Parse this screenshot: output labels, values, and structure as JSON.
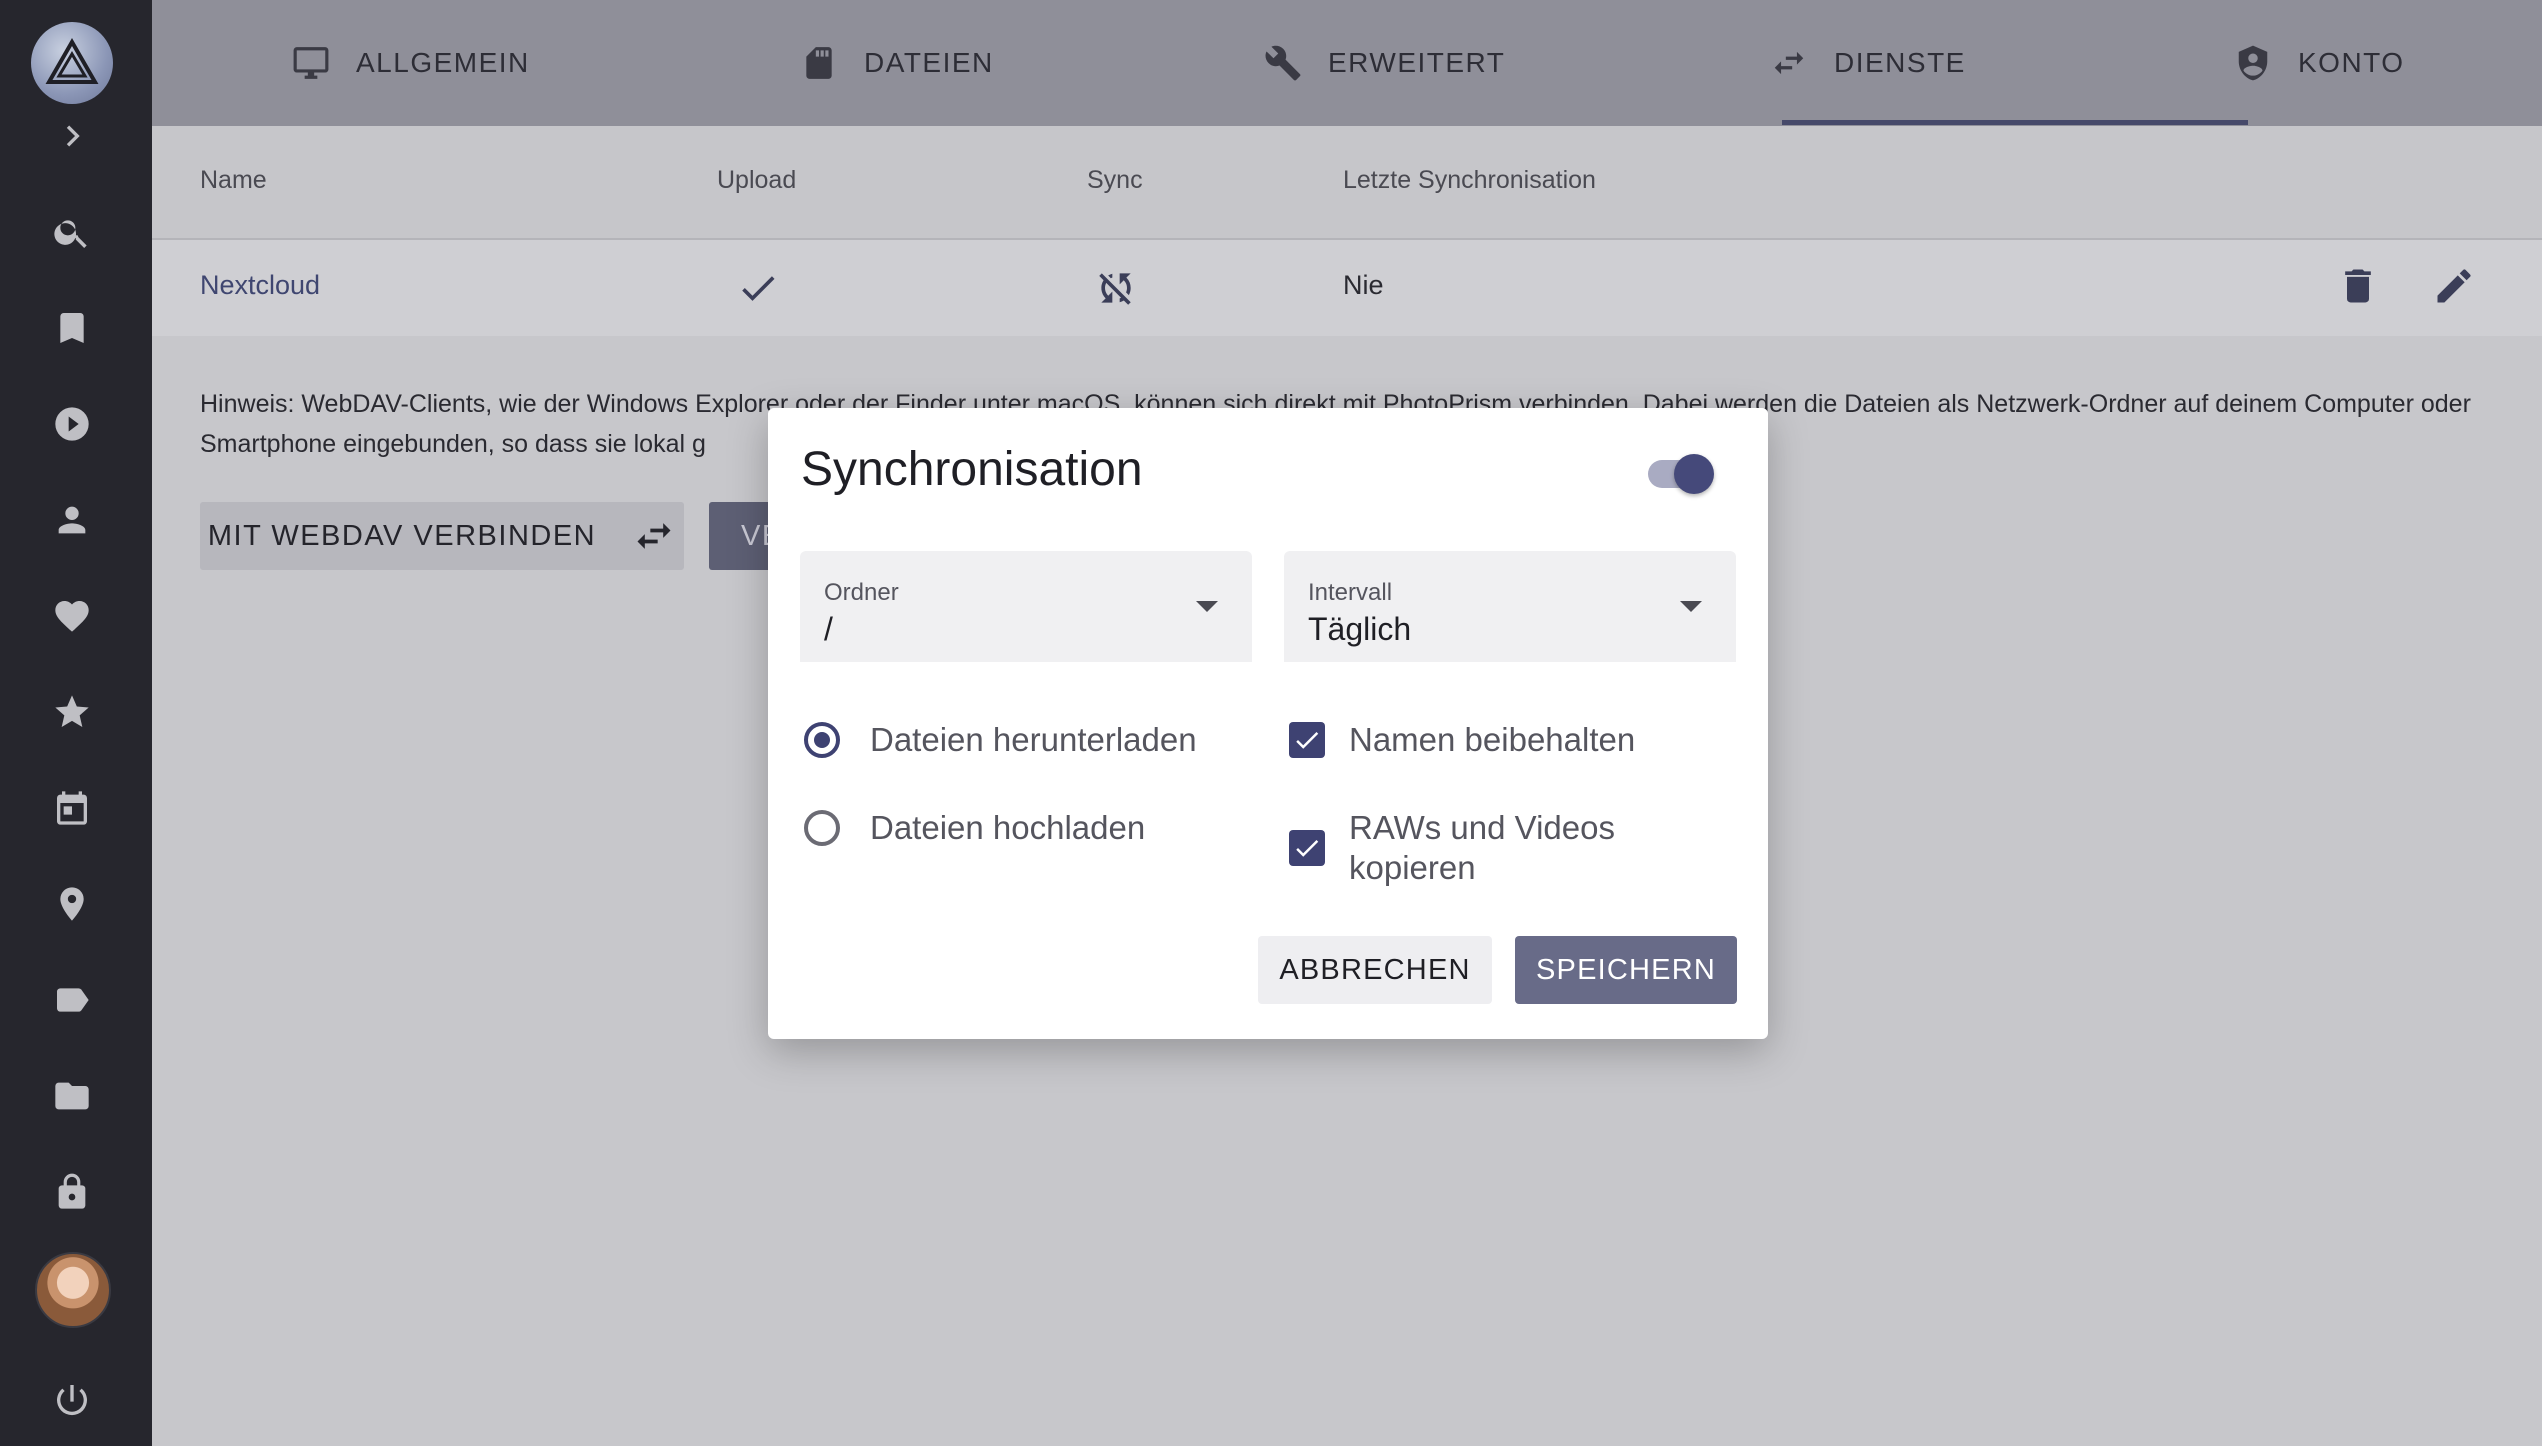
{
  "sidebar": {
    "items": [
      {
        "icon": "search-icon"
      },
      {
        "icon": "bookmark-icon"
      },
      {
        "icon": "play-icon"
      },
      {
        "icon": "person-icon"
      },
      {
        "icon": "heart-icon"
      },
      {
        "icon": "star-icon"
      },
      {
        "icon": "calendar-icon"
      },
      {
        "icon": "place-icon"
      },
      {
        "icon": "label-icon"
      },
      {
        "icon": "folder-icon"
      },
      {
        "icon": "lock-icon"
      }
    ]
  },
  "tabs": [
    {
      "label": "ALLGEMEIN",
      "icon": "monitor-icon"
    },
    {
      "label": "DATEIEN",
      "icon": "file-icon"
    },
    {
      "label": "ERWEITERT",
      "icon": "wrench-icon"
    },
    {
      "label": "DIENSTE",
      "icon": "swap-icon",
      "active": true
    },
    {
      "label": "KONTO",
      "icon": "shield-user-icon"
    }
  ],
  "table": {
    "headers": [
      "Name",
      "Upload",
      "Sync",
      "Letzte Synchronisation"
    ],
    "rows": [
      {
        "name": "Nextcloud",
        "upload": "check",
        "sync": "sync-disabled",
        "last_sync": "Nie"
      }
    ]
  },
  "hint": "Hinweis: WebDAV-Clients, wie der Windows Explorer oder der Finder unter macOS, können sich direkt mit PhotoPrism verbinden. Dabei werden die Dateien als Netzwerk-Ordner auf deinem Computer oder Smartphone eingebunden, so dass sie lokal g",
  "actions": {
    "webdav_label": "MIT WEBDAV VERBINDEN",
    "second_label": "VE"
  },
  "dialog": {
    "title": "Synchronisation",
    "enabled": true,
    "folder": {
      "label": "Ordner",
      "value": "/"
    },
    "interval": {
      "label": "Intervall",
      "value": "Täglich"
    },
    "download_label": "Dateien herunterladen",
    "upload_label": "Dateien hochladen",
    "keep_names_label": "Namen beibehalten",
    "raw_videos_line1": "RAWs und Videos",
    "raw_videos_line2": "kopieren",
    "cancel_label": "ABBRECHEN",
    "save_label": "SPEICHERN"
  },
  "colors": {
    "sidebar": "#26262d",
    "accent": "#3e4272",
    "save_button": "#686b88"
  }
}
